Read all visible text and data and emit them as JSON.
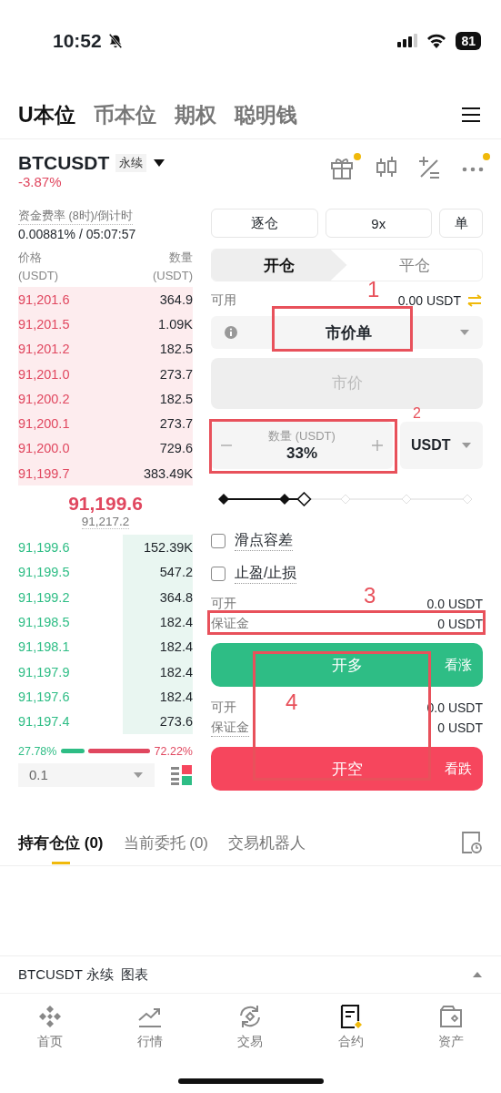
{
  "status_bar": {
    "time": "10:52",
    "battery": "81"
  },
  "market_tabs": [
    {
      "label": "U本位",
      "selected": true
    },
    {
      "label": "币本位",
      "selected": false
    },
    {
      "label": "期权",
      "selected": false
    },
    {
      "label": "聪明钱",
      "selected": false
    }
  ],
  "symbol": {
    "name": "BTCUSDT",
    "type": "永续",
    "change": "-3.87%"
  },
  "toolbar": [
    {
      "kind": "gift",
      "badge": true
    },
    {
      "kind": "candles",
      "badge": false
    },
    {
      "kind": "calculator",
      "badge": false
    },
    {
      "kind": "more",
      "badge": true
    }
  ],
  "funding": {
    "label": "资金费率 (8时)/倒计时",
    "value": "0.00881% / 05:07:57"
  },
  "order_book": {
    "price_header": "价格",
    "price_unit": "(USDT)",
    "qty_header": "数量",
    "qty_unit": "(USDT)",
    "asks": [
      {
        "price": "91,201.6",
        "qty": "364.9"
      },
      {
        "price": "91,201.5",
        "qty": "1.09K"
      },
      {
        "price": "91,201.2",
        "qty": "182.5"
      },
      {
        "price": "91,201.0",
        "qty": "273.7"
      },
      {
        "price": "91,200.2",
        "qty": "182.5"
      },
      {
        "price": "91,200.1",
        "qty": "273.7"
      },
      {
        "price": "91,200.0",
        "qty": "729.6"
      },
      {
        "price": "91,199.7",
        "qty": "383.49K"
      }
    ],
    "last_price": "91,199.6",
    "mark_price": "91,217.2",
    "bids": [
      {
        "price": "91,199.6",
        "qty": "152.39K"
      },
      {
        "price": "91,199.5",
        "qty": "547.2"
      },
      {
        "price": "91,199.2",
        "qty": "364.8"
      },
      {
        "price": "91,198.5",
        "qty": "182.4"
      },
      {
        "price": "91,198.1",
        "qty": "182.4"
      },
      {
        "price": "91,197.9",
        "qty": "182.4"
      },
      {
        "price": "91,197.6",
        "qty": "182.4"
      },
      {
        "price": "91,197.4",
        "qty": "273.6"
      }
    ],
    "buy_ratio": "27.78%",
    "sell_ratio": "72.22%",
    "level": 0.2778,
    "precision": "0.1"
  },
  "order_form": {
    "margin_mode": "逐仓",
    "leverage": "9x",
    "position_mode": "单",
    "sides": [
      {
        "label": "开仓",
        "selected": true
      },
      {
        "label": "平仓",
        "selected": false
      }
    ],
    "available_label": "可用",
    "available": "0.00 USDT",
    "order_type": "市价单",
    "price_placeholder": "市价",
    "amount": {
      "label": "数量 (USDT)",
      "value": "33%"
    },
    "unit": "USDT",
    "level": 0.33,
    "options": [
      {
        "label": "滑点容差",
        "checked": false
      },
      {
        "label": "止盈/止损",
        "checked": false
      }
    ],
    "actions": [
      {
        "kind": "long",
        "rows": [
          {
            "label": "可开",
            "value": "0.0 USDT"
          },
          {
            "label": "保证金",
            "value": "0 USDT"
          }
        ],
        "button": "开多",
        "hint": "看涨"
      },
      {
        "kind": "short",
        "rows": [
          {
            "label": "可开",
            "value": "0.0 USDT"
          },
          {
            "label": "保证金",
            "value": "0 USDT"
          }
        ],
        "button": "开空",
        "hint": "看跌"
      }
    ]
  },
  "annotations": [
    {
      "label": "1"
    },
    {
      "label": "2"
    },
    {
      "label": "3"
    },
    {
      "label": "4"
    }
  ],
  "position_tabs": [
    {
      "label": "持有仓位 (0)",
      "selected": true
    },
    {
      "label": "当前委托 (0)",
      "selected": false
    },
    {
      "label": "交易机器人",
      "selected": false
    }
  ],
  "chart_bar": {
    "title": "BTCUSDT 永续",
    "link": "图表"
  },
  "nav": [
    {
      "kind": "home",
      "label": "首页",
      "selected": false
    },
    {
      "kind": "markets",
      "label": "行情",
      "selected": false
    },
    {
      "kind": "trade",
      "label": "交易",
      "selected": false
    },
    {
      "kind": "futures",
      "label": "合约",
      "selected": true
    },
    {
      "kind": "assets",
      "label": "资产",
      "selected": false
    }
  ]
}
